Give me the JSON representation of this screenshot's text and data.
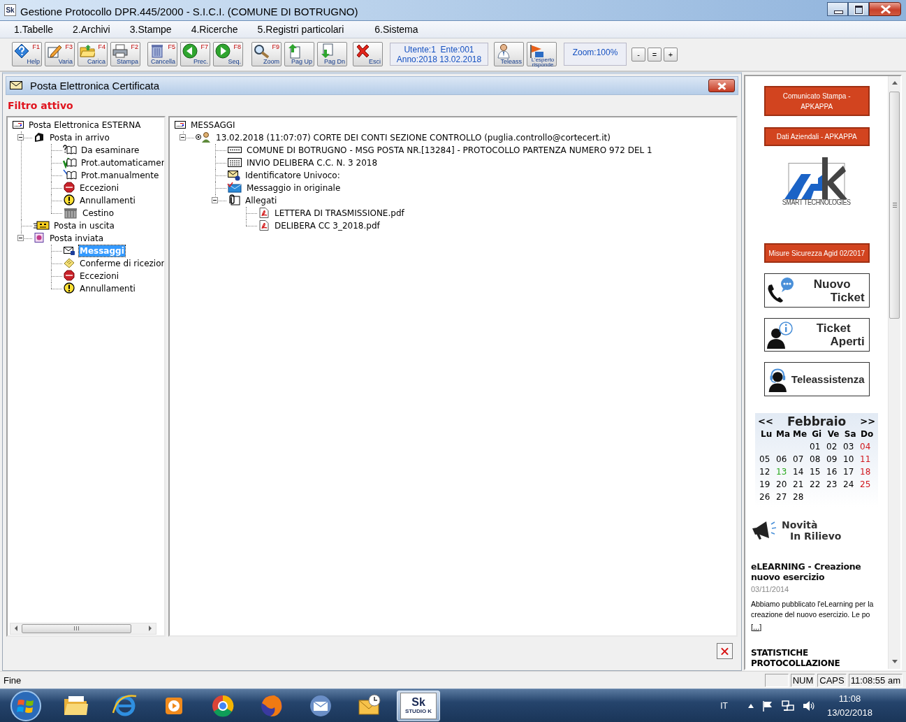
{
  "window": {
    "title": "Gestione Protocollo DPR.445/2000 - S.I.C.I. (COMUNE DI BOTRUGNO)",
    "icon_text": "Sk"
  },
  "menu": [
    "1.Tabelle",
    "2.Archivi",
    "3.Stampe",
    "4.Ricerche",
    "5.Registri particolari",
    "6.Sistema"
  ],
  "toolbar": {
    "buttons": [
      {
        "key": "F1",
        "label": "Help"
      },
      {
        "key": "F3",
        "label": "Varia"
      },
      {
        "key": "F4",
        "label": "Carica"
      },
      {
        "key": "F2",
        "label": "Stampa"
      },
      {
        "key": "F5",
        "label": "Cancella"
      },
      {
        "key": "F7",
        "label": "Prec."
      },
      {
        "key": "F8",
        "label": "Seq."
      },
      {
        "key": "F9",
        "label": "Zoom"
      },
      {
        "label": "Pag Up"
      },
      {
        "label": "Pag Dn"
      },
      {
        "label": "Esci"
      }
    ],
    "session": [
      "Utente:1  Ente:001",
      "Anno:2018 13.02.2018"
    ],
    "help_buttons": [
      {
        "label": "Teleass"
      },
      {
        "label": "L'esperto risponde"
      }
    ],
    "zoom": {
      "label": "Zoom:100%",
      "buttons": [
        "-",
        "=",
        "+"
      ]
    }
  },
  "pec_window": {
    "title": "Posta Elettronica Certificata",
    "filter": "Filtro attivo",
    "folder_tree": {
      "label": "Posta Elettronica ESTERNA",
      "kind": "panel",
      "selected": false,
      "children": [
        {
          "label": "Posta in arrivo",
          "kind": "inbox",
          "selected": false,
          "expanded": true,
          "children": [
            {
              "label": "Da esaminare",
              "kind": "review",
              "selected": false
            },
            {
              "label": "Prot.automaticamer",
              "kind": "auto",
              "selected": false
            },
            {
              "label": "Prot.manualmente",
              "kind": "manual",
              "selected": false
            },
            {
              "label": "Eccezioni",
              "kind": "stop",
              "selected": false
            },
            {
              "label": "Annullamenti",
              "kind": "warning",
              "selected": false
            },
            {
              "label": "Cestino",
              "kind": "trash",
              "selected": false
            }
          ]
        },
        {
          "label": "Posta in uscita",
          "kind": "outbox",
          "selected": false
        },
        {
          "label": "Posta inviata",
          "kind": "sent",
          "selected": false,
          "expanded": true,
          "children": [
            {
              "label": "Messaggi",
              "kind": "message",
              "selected": true
            },
            {
              "label": "Conferme di ricezior",
              "kind": "receipt",
              "selected": false
            },
            {
              "label": "Eccezioni",
              "kind": "stop",
              "selected": false
            },
            {
              "label": "Annullamenti",
              "kind": "warning",
              "selected": false
            }
          ]
        }
      ]
    },
    "message_tree": {
      "label": "MESSAGGI",
      "kind": "panel",
      "selected": false,
      "children": [
        {
          "label": "13.02.2018 (11:07:07) CORTE DEI CONTI SEZIONE CONTROLLO (puglia.controllo@cortecert.it)",
          "kind": "sender",
          "selected": false,
          "expanded": true,
          "children": [
            {
              "label": "COMUNE DI BOTRUGNO - MSG POSTA NR.[13284] - PROTOCOLLO PARTENZA NUMERO 972 DEL 1",
              "kind": "subject",
              "selected": false
            },
            {
              "label": "INVIO DELIBERA C.C. N. 3 2018",
              "kind": "text",
              "selected": false
            },
            {
              "label": "Identificatore Univoco:",
              "kind": "id",
              "selected": false
            },
            {
              "label": "Messaggio in originale",
              "kind": "original",
              "selected": false
            },
            {
              "label": "Allegati",
              "kind": "attachments",
              "selected": false,
              "expanded": true,
              "children": [
                {
                  "label": "LETTERA DI TRASMISSIONE.pdf",
                  "kind": "pdf",
                  "selected": false
                },
                {
                  "label": "DELIBERA CC 3_2018.pdf",
                  "kind": "pdf",
                  "selected": false
                }
              ]
            }
          ]
        }
      ]
    }
  },
  "side_panel": {
    "top_links": [
      "Comunicato Stampa - APKAPPA",
      "Dati Aziendali - APKAPPA"
    ],
    "logo_caption": "SMART TECHNOLOGIES",
    "notice_link": "Misure Sicurezza Agid 02/2017",
    "tiles": [
      {
        "kind": "phone",
        "lines": [
          "Nuovo",
          "Ticket"
        ]
      },
      {
        "kind": "info",
        "lines": [
          "Ticket",
          "Aperti"
        ]
      },
      {
        "kind": "headset",
        "lines": [
          "Teleassistenza"
        ]
      }
    ],
    "calendar": {
      "prev": "<<",
      "month": "Febbraio",
      "next": ">>",
      "weekdays": [
        "Lu",
        "Ma",
        "Me",
        "Gi",
        "Ve",
        "Sa",
        "Do"
      ],
      "weeks": [
        [
          {
            "day": "01",
            "kind": "weekday"
          },
          {
            "day": "02",
            "kind": "weekday"
          },
          {
            "day": "03",
            "kind": "weekday"
          },
          {
            "day": "04",
            "kind": "sunday"
          }
        ],
        [
          {
            "day": "05",
            "kind": "weekday"
          },
          {
            "day": "06",
            "kind": "weekday"
          },
          {
            "day": "07",
            "kind": "weekday"
          },
          {
            "day": "08",
            "kind": "weekday"
          },
          {
            "day": "09",
            "kind": "weekday"
          },
          {
            "day": "10",
            "kind": "weekday"
          },
          {
            "day": "11",
            "kind": "sunday"
          }
        ],
        [
          {
            "day": "12",
            "kind": "weekday"
          },
          {
            "day": "13",
            "kind": "today"
          },
          {
            "day": "14",
            "kind": "weekday"
          },
          {
            "day": "15",
            "kind": "weekday"
          },
          {
            "day": "16",
            "kind": "weekday"
          },
          {
            "day": "17",
            "kind": "weekday"
          },
          {
            "day": "18",
            "kind": "sunday"
          }
        ],
        [
          {
            "day": "19",
            "kind": "weekday"
          },
          {
            "day": "20",
            "kind": "weekday"
          },
          {
            "day": "21",
            "kind": "weekday"
          },
          {
            "day": "22",
            "kind": "weekday"
          },
          {
            "day": "23",
            "kind": "weekday"
          },
          {
            "day": "24",
            "kind": "weekday"
          },
          {
            "day": "25",
            "kind": "sunday"
          }
        ],
        [
          {
            "day": "26",
            "kind": "weekday"
          },
          {
            "day": "27",
            "kind": "weekday"
          },
          {
            "day": "28",
            "kind": "weekday"
          }
        ]
      ]
    },
    "news": {
      "heading": [
        "Novità",
        "In Rilievo"
      ],
      "title": "eLEARNING - Creazione nuovo esercizio",
      "date": "03/11/2014",
      "summary": "Abbiamo pubblicato l'eLearning per la creazione del nuovo esercizio. Le po",
      "more": "[...]",
      "next_title": "STATISTICHE PROTOCOLLAZIONE"
    }
  },
  "status_bar": {
    "text": "Fine",
    "panels": [
      "NUM",
      "CAPS",
      "11:08:55 am"
    ]
  },
  "taskbar": {
    "apps": [
      {
        "kind": "folder",
        "selected": false
      },
      {
        "kind": "browser",
        "selected": false
      },
      {
        "kind": "player",
        "selected": false
      },
      {
        "kind": "wheel",
        "selected": false
      },
      {
        "kind": "fox",
        "selected": false
      },
      {
        "kind": "mail",
        "selected": false
      },
      {
        "kind": "organizer",
        "selected": false
      },
      {
        "kind": "app",
        "selected": true,
        "label": "Sk",
        "caption": "STUDIO K"
      }
    ],
    "language": "IT",
    "clock": {
      "time": "11:08",
      "date": "13/02/2018"
    }
  }
}
